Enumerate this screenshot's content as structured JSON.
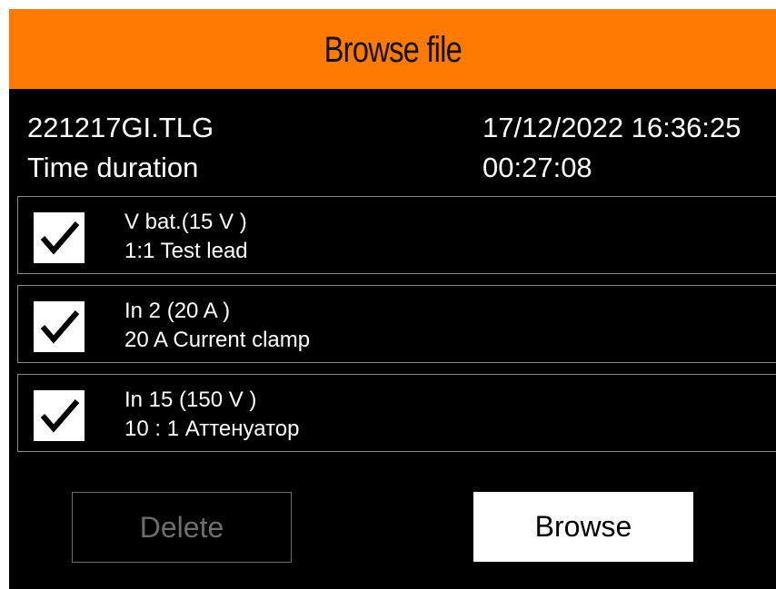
{
  "header": {
    "title": "Browse file"
  },
  "file_info": {
    "filename": "221217GI.TLG",
    "datetime": "17/12/2022 16:36:25",
    "duration_label": "Time duration",
    "duration_value": "00:27:08"
  },
  "channels": [
    {
      "checked": true,
      "name": "V bat.(15 V  )",
      "probe": "1:1 Test lead"
    },
    {
      "checked": true,
      "name": "In 2 (20 A  )",
      "probe": "20 A Current clamp"
    },
    {
      "checked": true,
      "name": "In 15 (150 V  )",
      "probe": "10 : 1 Аттенуатор"
    }
  ],
  "buttons": {
    "delete_label": "Delete",
    "browse_label": "Browse"
  },
  "colors": {
    "title_bar": "#ff7a00",
    "background": "#000000",
    "text": "#ffffff",
    "disabled": "#6e6e6e"
  },
  "icons": {
    "checkbox": "checkmark-icon"
  }
}
